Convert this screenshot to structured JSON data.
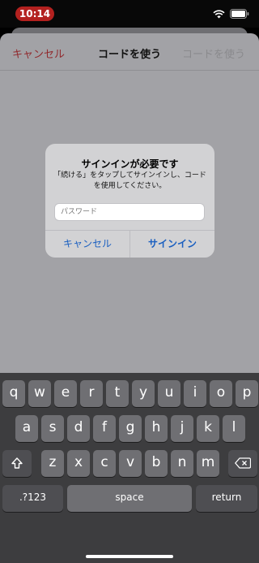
{
  "status": {
    "time": "10:14",
    "time_color": "#b3211f"
  },
  "nav": {
    "cancel": "キャンセル",
    "title": "コードを使う",
    "use": "コードを使う"
  },
  "alert": {
    "title": "サインインが必要です",
    "message": "「続ける」をタップしてサインインし、コードを使用してください。",
    "password_placeholder": "パスワード",
    "cancel": "キャンセル",
    "sign_in": "サインイン"
  },
  "keyboard": {
    "row1": [
      "q",
      "w",
      "e",
      "r",
      "t",
      "y",
      "u",
      "i",
      "o",
      "p"
    ],
    "row2": [
      "a",
      "s",
      "d",
      "f",
      "g",
      "h",
      "j",
      "k",
      "l"
    ],
    "row3": [
      "z",
      "x",
      "c",
      "v",
      "b",
      "n",
      "m"
    ],
    "shift_icon": "shift-icon",
    "delete_icon": "delete-icon",
    "numbers": ".?123",
    "space": "space",
    "return": "return"
  },
  "colors": {
    "accent": "#1a5fc0",
    "cancel_red": "#912a2e"
  }
}
